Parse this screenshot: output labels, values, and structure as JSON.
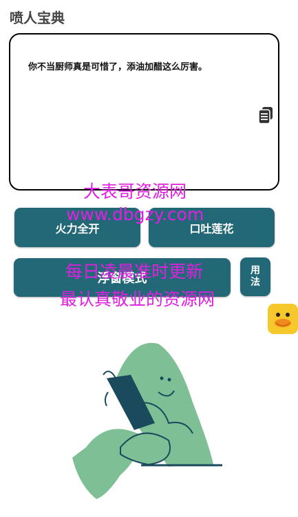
{
  "app_title": "喷人宝典",
  "text_card": {
    "content": "你不当厨师真是可惜了，添油加醋这么厉害。"
  },
  "buttons": {
    "fire": "火力全开",
    "lotus": "口吐莲花",
    "float": "浮窗模式",
    "usage_line1": "用",
    "usage_line2": "法"
  },
  "watermark": {
    "line1": "大表哥资源网",
    "line2": "www.dbgzy.com",
    "line3": "每日凌晨准时更新",
    "line4": "最认真敬业的资源网"
  },
  "icons": {
    "copy": "copy-icon",
    "duck": "duck-icon",
    "illustration": "person-reading-phone-illustration"
  },
  "colors": {
    "button_bg": "#236877",
    "watermark": "#e020e0",
    "illustration_green": "#7fbf95",
    "illustration_navy": "#1a4a5c",
    "duck_yellow": "#f7c82b"
  }
}
